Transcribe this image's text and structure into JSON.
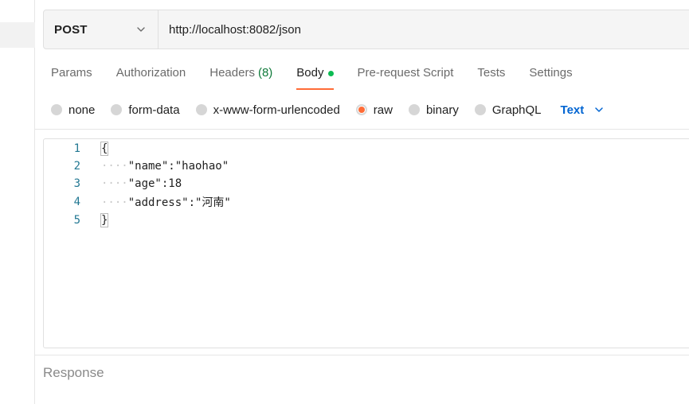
{
  "request": {
    "method": "POST",
    "url": "http://localhost:8082/json"
  },
  "tabs": [
    {
      "label": "Params"
    },
    {
      "label": "Authorization"
    },
    {
      "label": "Headers",
      "count": "(8)"
    },
    {
      "label": "Body"
    },
    {
      "label": "Pre-request Script"
    },
    {
      "label": "Tests"
    },
    {
      "label": "Settings"
    }
  ],
  "body_types": {
    "options": [
      "none",
      "form-data",
      "x-www-form-urlencoded",
      "raw",
      "binary",
      "GraphQL"
    ],
    "selected": "raw",
    "format": "Text"
  },
  "editor": {
    "lines": [
      {
        "num": "1",
        "indent": "",
        "text": "{"
      },
      {
        "num": "2",
        "indent": "····",
        "text": "\"name\":\"haohao\""
      },
      {
        "num": "3",
        "indent": "····",
        "text": "\"age\":18"
      },
      {
        "num": "4",
        "indent": "····",
        "text": "\"address\":\"河南\""
      },
      {
        "num": "5",
        "indent": "",
        "text": "}"
      }
    ]
  },
  "response": {
    "label": "Response"
  },
  "colors": {
    "accent": "#ff6c37",
    "active_dot": "#0cbb52",
    "link_blue": "#0265d2",
    "count_green": "#0f7a3a"
  },
  "icons": {
    "method_dropdown": "chevron-down-icon",
    "format_dropdown": "chevron-down-icon"
  }
}
